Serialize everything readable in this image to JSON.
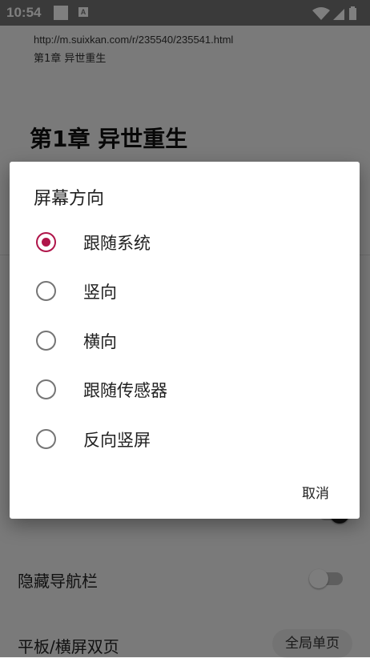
{
  "status_bar": {
    "time": "10:54",
    "a_icon": "A"
  },
  "background": {
    "url": "http://m.suixkan.com/r/235540/235541.html",
    "chapter_small": "第1章 异世重生",
    "chapter_title": "第1章 异世重生",
    "rows": [
      {
        "label": "隐藏导航栏",
        "toggle": "off"
      },
      {
        "label": "平板/横屏双页",
        "value": "全局单页"
      }
    ],
    "colors": {
      "scrim": "rgba(0,0,0,0.5)"
    }
  },
  "dialog": {
    "title": "屏幕方向",
    "options": [
      {
        "label": "跟随系统",
        "checked": true
      },
      {
        "label": "竖向",
        "checked": false
      },
      {
        "label": "横向",
        "checked": false
      },
      {
        "label": "跟随传感器",
        "checked": false
      },
      {
        "label": "反向竖屏",
        "checked": false
      }
    ],
    "cancel_label": "取消",
    "accent_color": "#b0154a"
  },
  "icons": [
    "wifi-icon",
    "signal-icon",
    "battery-icon",
    "notification-icon",
    "a-icon",
    "radio-icon"
  ]
}
